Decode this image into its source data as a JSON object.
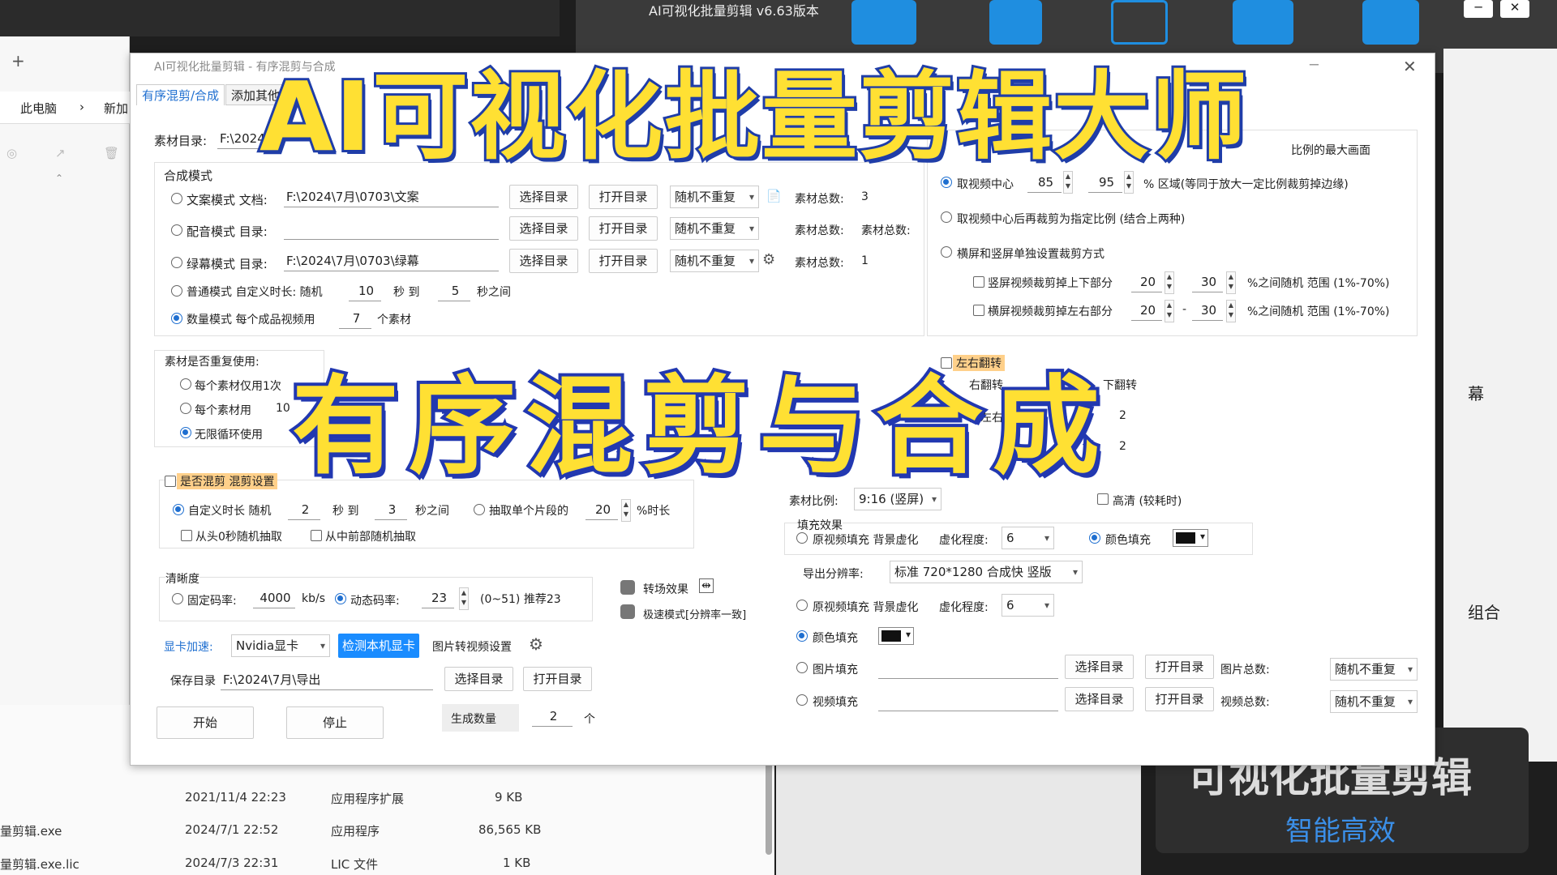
{
  "overlay": {
    "title": "AI可视化批量剪辑大师",
    "subtitle": "有序混剪与合成"
  },
  "explorer": {
    "add_tab": "+",
    "breadcrumb": [
      "此电脑",
      "›",
      "新加"
    ],
    "files": [
      {
        "name": "",
        "date": "2021/11/4 22:23",
        "type": "应用程序扩展",
        "size": "9 KB"
      },
      {
        "name": "量剪辑.exe",
        "date": "2024/7/1 22:52",
        "type": "应用程序",
        "size": "86,565 KB"
      },
      {
        "name": "量剪辑.exe.lic",
        "date": "2024/7/3 22:31",
        "type": "LIC 文件",
        "size": "1 KB"
      }
    ]
  },
  "background_app": {
    "title": "AI可视化批量剪辑 v6.63版本",
    "promo_line1": "可视化批量剪辑",
    "promo_line2": "智能高效",
    "side_items": [
      "幕",
      "组合"
    ]
  },
  "dialog": {
    "title": "AI可视化批量剪辑 - 有序混剪与合成",
    "tabs": [
      "有序混剪/合成",
      "添加其他"
    ],
    "source_dir_label": "素材目录:",
    "source_dir_value": "F:\\2024",
    "compose_mode_title": "合成模式",
    "modes": {
      "text": {
        "label": "文案模式 文档:",
        "path": "F:\\2024\\7月\\0703\\文案",
        "count_label": "素材总数:",
        "count": "3",
        "order": "随机不重复"
      },
      "voice": {
        "label": "配音模式 目录:",
        "path": "",
        "count_label": "素材总数:",
        "count_label2": "素材总数:",
        "order": "随机不重复"
      },
      "green": {
        "label": "绿幕模式 目录:",
        "path": "F:\\2024\\7月\\0703\\绿幕",
        "count_label": "素材总数:",
        "count": "1",
        "order": "随机不重复"
      },
      "normal": {
        "label": "普通模式 自定义时长: 随机",
        "min": "10",
        "to": "秒 到",
        "max": "5",
        "unit": "秒之间"
      },
      "quantity": {
        "label": "数量模式 每个成品视频用",
        "value": "7",
        "unit": "个素材"
      }
    },
    "buttons": {
      "select_dir": "选择目录",
      "open_dir": "打开目录",
      "start": "开始",
      "stop": "停止",
      "detect_gpu": "检测本机显卡"
    },
    "reuse": {
      "title": "素材是否重复使用:",
      "once": "每个素材仅用1次",
      "each": "每个素材用",
      "each_value": "10",
      "loop": "无限循环使用"
    },
    "mix": {
      "title": "是否混剪 混剪设置",
      "custom": "自定义时长 随机",
      "min": "2",
      "to": "秒 到",
      "max": "3",
      "unit": "秒之间",
      "single": "抽取单个片段的",
      "single_value": "20",
      "single_unit": "%时长",
      "from_start": "从头0秒随机抽取",
      "from_middle": "从中前部随机抽取"
    },
    "quality": {
      "title": "清晰度",
      "fixed": "固定码率:",
      "fixed_value": "4000",
      "unit": "kb/s",
      "dynamic": "动态码率:",
      "dynamic_value": "23",
      "range": "(0~51) 推荐23",
      "transition": "转场效果",
      "fast": "极速模式[分辨率一致]"
    },
    "gpu": {
      "label": "显卡加速:",
      "value": "Nvidia显卡",
      "img_settings": "图片转视频设置"
    },
    "save": {
      "label": "保存目录",
      "path": "F:\\2024\\7月\\导出"
    },
    "generate": {
      "label": "生成数量",
      "value": "2",
      "unit": "个"
    },
    "crop": {
      "top_note": "比例的最大画面",
      "center": "取视频中心",
      "center_a": "85",
      "center_b": "95",
      "center_unit": "% 区域(等同于放大一定比例裁剪掉边缘)",
      "center_then": "取视频中心后再裁剪为指定比例 (结合上两种)",
      "separate": "横屏和竖屏单独设置裁剪方式",
      "vertical": "竖屏视频裁剪掉上下部分",
      "v_a": "20",
      "v_b": "30",
      "v_unit": "%之间随机 范围 (1%-70%)",
      "horizontal": "横屏视频裁剪掉左右部分",
      "h_a": "20",
      "h_dash": "-",
      "h_b": "30",
      "h_unit": "%之间随机 范围 (1%-70%)"
    },
    "flip": {
      "lr": "左右翻转",
      "lr2": "右翻转",
      "ud": "下翻转",
      "left_part": "隔左右",
      "v1": "2",
      "v2": "2"
    },
    "ratio": {
      "label": "素材比例:",
      "value": "9:16 (竖屏)",
      "hd": "高清 (较耗时)",
      "fill_title": "填充效果",
      "orig_fill": "原视频填充 背景虚化",
      "blur_label": "虚化程度:",
      "blur_value": "6",
      "color_fill": "颜色填充",
      "export_label": "导出分辨率:",
      "export_value": "标准 720*1280 合成快 竖版",
      "orig_fill2": "原视频填充 背景虚化",
      "blur_label2": "虚化程度:",
      "blur_value2": "6",
      "color_fill2": "颜色填充",
      "img_fill": "图片填充",
      "img_total": "图片总数:",
      "img_order": "随机不重复",
      "video_fill": "视频填充",
      "video_total": "视频总数:",
      "video_order": "随机不重复"
    }
  },
  "colors": {
    "accent": "#1f6fd0",
    "title_fill": "#ffe033",
    "title_stroke": "#1f3da8"
  }
}
